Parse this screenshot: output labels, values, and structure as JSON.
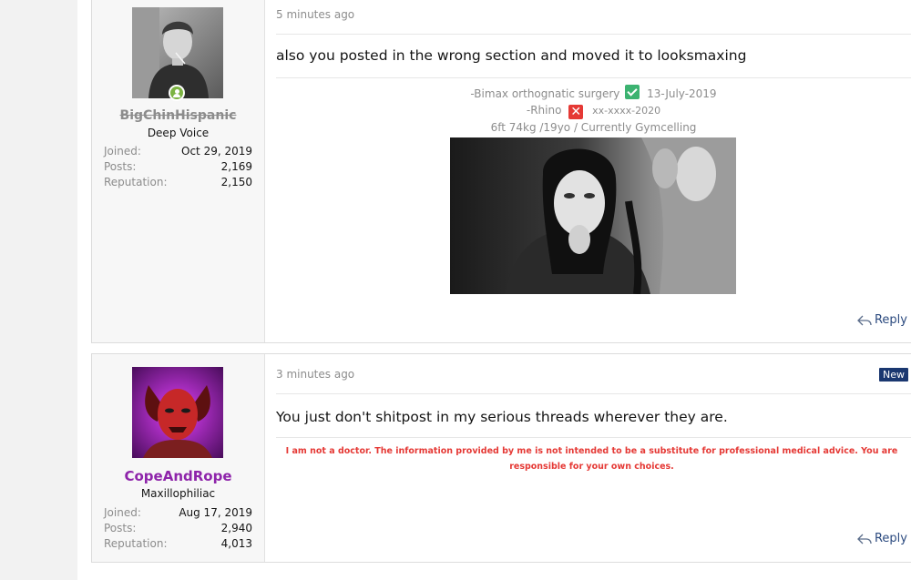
{
  "posts": [
    {
      "username": "BigChinHispanic",
      "user_title": "Deep Voice",
      "online_status": "online",
      "stats": [
        {
          "label": "Joined:",
          "value": "Oct 29, 2019"
        },
        {
          "label": "Posts:",
          "value": "2,169"
        },
        {
          "label": "Reputation:",
          "value": "2,150"
        }
      ],
      "timestamp": "5 minutes ago",
      "message": "also you posted in the wrong section and moved it to looksmaxing",
      "signature": {
        "line1_text": "-Bimax orthognatic surgery",
        "line1_icon": "check-icon",
        "line1_date": "13-July-2019",
        "line2_text": "-Rhino",
        "line2_icon": "cross-icon",
        "line2_date": "xx-xxxx-2020",
        "line3_text": "6ft 74kg /19yo / Currently Gymcelling"
      },
      "reply_label": "Reply"
    },
    {
      "username": "CopeAndRope",
      "user_title": "Maxillophiliac",
      "stats": [
        {
          "label": "Joined:",
          "value": "Aug 17, 2019"
        },
        {
          "label": "Posts:",
          "value": "2,940"
        },
        {
          "label": "Reputation:",
          "value": "4,013"
        }
      ],
      "timestamp": "3 minutes ago",
      "badge": "New",
      "message": "You just don't shitpost in my serious threads wherever they are.",
      "disclaimer": "I am not a doctor. The information provided by me is not intended to be a substitute for professional medical advice. You are responsible for your own choices.",
      "reply_label": "Reply"
    }
  ],
  "colors": {
    "accent_link": "#2b4a7f",
    "username_2": "#8e24aa",
    "badge_bg": "#1a3770",
    "disclaimer": "#e53935",
    "check": "#3cb371",
    "cross": "#e53935"
  }
}
